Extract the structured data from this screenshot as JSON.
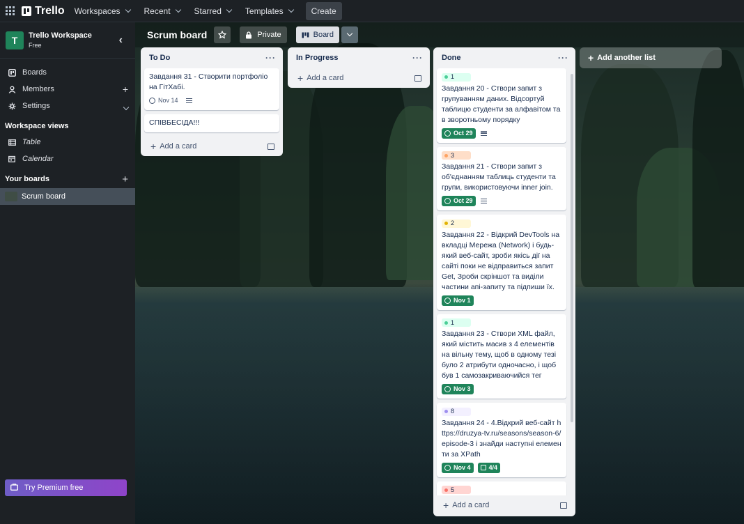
{
  "topbar": {
    "brand": "Trello",
    "nav": [
      "Workspaces",
      "Recent",
      "Starred",
      "Templates"
    ],
    "create": "Create"
  },
  "sidebar": {
    "workspace_initial": "T",
    "workspace_name": "Trello Workspace",
    "workspace_plan": "Free",
    "items": [
      {
        "label": "Boards",
        "icon": "board-icon"
      },
      {
        "label": "Members",
        "icon": "person-icon"
      },
      {
        "label": "Settings",
        "icon": "gear-icon"
      }
    ],
    "views_title": "Workspace views",
    "views": [
      {
        "label": "Table",
        "icon": "table-icon"
      },
      {
        "label": "Calendar",
        "icon": "calendar-icon"
      }
    ],
    "your_boards_title": "Your boards",
    "boards": [
      {
        "label": "Scrum board"
      }
    ],
    "premium": "Try Premium free"
  },
  "board": {
    "title": "Scrum board",
    "visibility": "Private",
    "view": "Board",
    "add_list": "Add another list",
    "lists": [
      {
        "title": "To Do",
        "cards": [
          {
            "title": "Завдання 31 - Створити портфоліо на ГітХабі.",
            "due": "Nov 14",
            "due_style": "plain",
            "has_desc": true
          },
          {
            "title": "СПІВБЕСІДА!!!"
          }
        ],
        "add_card": "Add a card"
      },
      {
        "title": "In Progress",
        "cards": [],
        "add_card": "Add a card"
      },
      {
        "title": "Done",
        "cards": [
          {
            "label": "1",
            "label_color": "#4bce97",
            "label_bg": "#dcfff1",
            "title": "Завдання 20 - Створи запит з групуванням даних. Відсортуй таблицю студенти за алфавітом та в зворотньому порядку",
            "due": "Oct 29",
            "has_desc": true
          },
          {
            "label": "3",
            "label_color": "#fea362",
            "label_bg": "#fedec8",
            "title": "Завдання 21 - Створи запит з об'єднанням таблиць студенти та групи, використовуючи inner join.",
            "due": "Oct 29",
            "has_desc": true
          },
          {
            "label": "2",
            "label_color": "#e2b203",
            "label_bg": "#fff7d6",
            "title": "Завдання 22 - Відкрий DevTools на вкладці Мережа (Network) і будь-який веб-сайт, зроби якісь дії на сайті поки не відправиться запит Get, Зроби скріншот та виділи частини апі-запиту та підпиши їх.",
            "due": "Nov 1"
          },
          {
            "label": "1",
            "label_color": "#4bce97",
            "label_bg": "#dcfff1",
            "title": "Завдання 23 - Створи XML файл, який містить масив з 4 елементів на вільну тему, щоб в одному тезі було 2 атрибути одночасно, і щоб був 1 самозакриваючийся тег",
            "due": "Nov 3"
          },
          {
            "label": "8",
            "label_color": "#9f8fef",
            "label_bg": "#f3f0ff",
            "title": "Завдання 24 - 4.Відкрий веб-сайт https://druzya-tv.ru/seasons/season-6/episode-3 і знайди наступні елементи за XPath",
            "due": "Nov 4",
            "checklist": "4/4"
          },
          {
            "label": "5",
            "label_color": "#f87168",
            "label_bg": "#ffd5d2",
            "title": ""
          }
        ],
        "add_card": "Add a card"
      }
    ]
  }
}
